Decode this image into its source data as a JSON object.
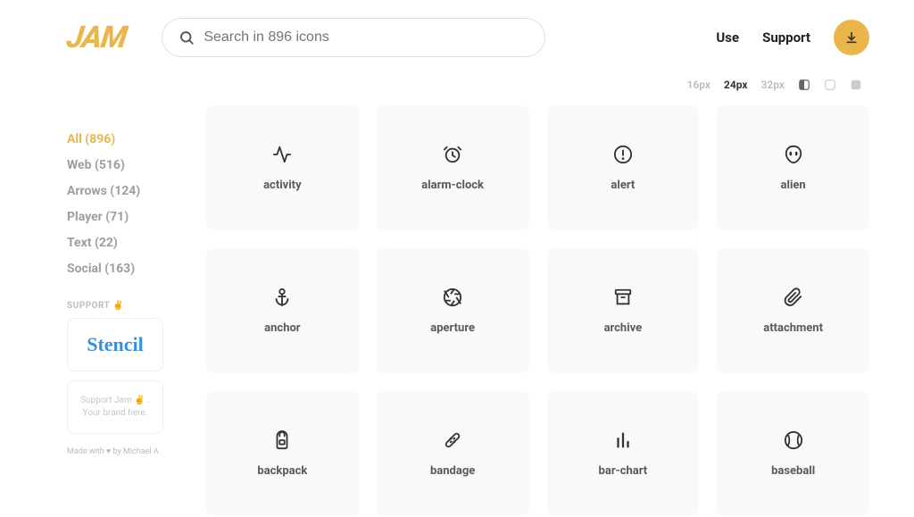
{
  "logo": "JAM",
  "search": {
    "placeholder": "Search in 896 icons"
  },
  "nav": {
    "use": "Use",
    "support": "Support"
  },
  "sidebar": {
    "categories": [
      {
        "label": "All (896)",
        "active": true
      },
      {
        "label": "Web (516)",
        "active": false
      },
      {
        "label": "Arrows (124)",
        "active": false
      },
      {
        "label": "Player (71)",
        "active": false
      },
      {
        "label": "Text (22)",
        "active": false
      },
      {
        "label": "Social (163)",
        "active": false
      }
    ],
    "support_label": "SUPPORT ✌️",
    "stencil": "Stencil",
    "promo": "Support Jam ✌️ .\nYour brand here.",
    "credit": "Made with ♥ by Michael A"
  },
  "toolbar": {
    "sizes": [
      "16px",
      "24px",
      "32px"
    ],
    "active_size": "24px"
  },
  "icons": [
    {
      "name": "activity"
    },
    {
      "name": "alarm-clock"
    },
    {
      "name": "alert"
    },
    {
      "name": "alien"
    },
    {
      "name": "anchor"
    },
    {
      "name": "aperture"
    },
    {
      "name": "archive"
    },
    {
      "name": "attachment"
    },
    {
      "name": "backpack"
    },
    {
      "name": "bandage"
    },
    {
      "name": "bar-chart"
    },
    {
      "name": "baseball"
    }
  ]
}
